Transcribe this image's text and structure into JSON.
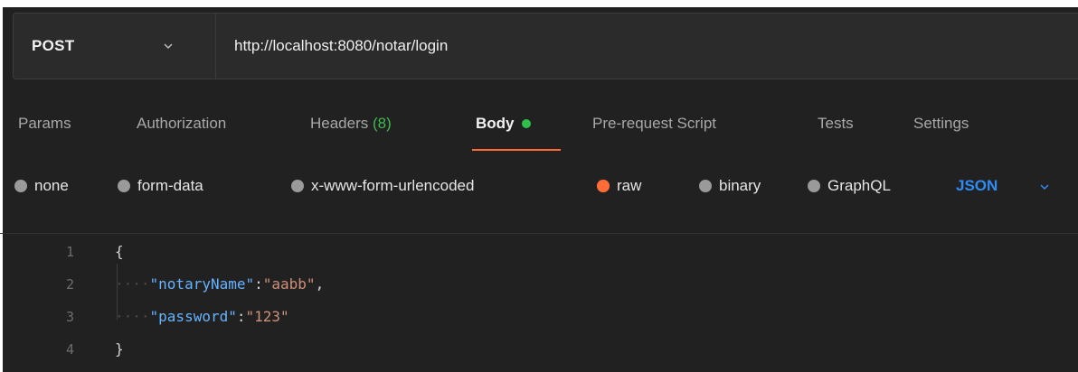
{
  "request": {
    "method": "POST",
    "url": "http://localhost:8080/notar/login"
  },
  "tabs": [
    {
      "label": "Params"
    },
    {
      "label": "Authorization"
    },
    {
      "label": "Headers",
      "count": "(8)"
    },
    {
      "label": "Body",
      "active": true
    },
    {
      "label": "Pre-request Script"
    },
    {
      "label": "Tests"
    },
    {
      "label": "Settings"
    }
  ],
  "body_modes": [
    {
      "label": "none",
      "selected": false
    },
    {
      "label": "form-data",
      "selected": false
    },
    {
      "label": "x-www-form-urlencoded",
      "selected": false
    },
    {
      "label": "raw",
      "selected": true
    },
    {
      "label": "binary",
      "selected": false
    },
    {
      "label": "GraphQL",
      "selected": false
    }
  ],
  "format": "JSON",
  "editor": {
    "lines": [
      {
        "num": "1",
        "text": "{"
      },
      {
        "num": "2",
        "indent": "····",
        "key": "\"notaryName\"",
        "sep": ":",
        "value": "\"aabb\"",
        "trail": ","
      },
      {
        "num": "3",
        "indent": "····",
        "key": "\"password\"",
        "sep": ":",
        "value": "\"123\"",
        "trail": ""
      },
      {
        "num": "4",
        "text": "}"
      }
    ]
  },
  "colors": {
    "accent": "#ff6c37",
    "format_blue": "#2f8cf5",
    "active_dot": "#2fbf4b"
  }
}
